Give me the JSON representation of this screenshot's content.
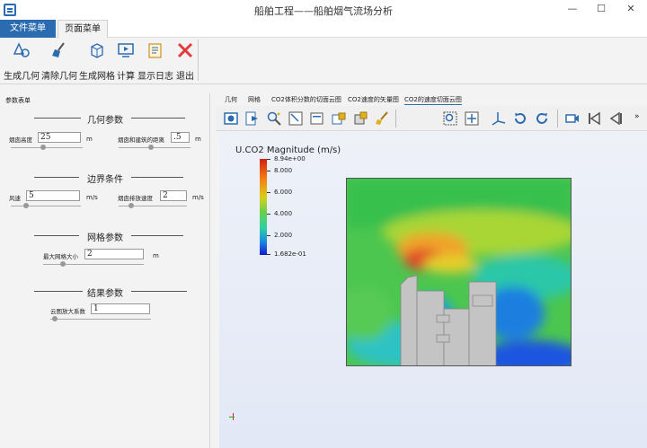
{
  "window": {
    "title": "船舶工程——船舶烟气流场分析",
    "minimize": "—",
    "restore": "☐",
    "close": "✕"
  },
  "menu": {
    "file": "文件菜单",
    "page": "页面菜单"
  },
  "toolbar": [
    {
      "label": "生成几何",
      "icon": "shapes-icon"
    },
    {
      "label": "清除几何",
      "icon": "broom-icon"
    },
    {
      "label": "生成网格",
      "icon": "cube-mesh-icon"
    },
    {
      "label": "计算",
      "icon": "monitor-play-icon"
    },
    {
      "label": "显示日志",
      "icon": "log-document-icon"
    },
    {
      "label": "退出",
      "icon": "exit-x-icon"
    }
  ],
  "left_panel": {
    "title": "参数表单",
    "sections": {
      "geometry": "几何参数",
      "boundary": "边界条件",
      "mesh": "网格参数",
      "result": "结果参数"
    },
    "params": {
      "stack_height": {
        "label": "烟囱高度",
        "value": "25",
        "unit": "m"
      },
      "stack_distance": {
        "label": "烟囱和建筑的距离",
        "value": ".5",
        "unit": "m"
      },
      "wind_speed": {
        "label": "风速",
        "value": "5",
        "unit": "m/s"
      },
      "exhaust_speed": {
        "label": "烟囱排放速度",
        "value": "2",
        "unit": "m/s"
      },
      "max_mesh": {
        "label": "最大网格大小",
        "value": "2",
        "unit": "m"
      },
      "contour_scale": {
        "label": "云图放大系数",
        "value": "1",
        "unit": ""
      }
    },
    "slider_levels": {
      "stack_height": 0.45,
      "stack_distance": 0.45,
      "wind_speed": 0.2,
      "exhaust_speed": 0.15,
      "max_mesh": 0.18,
      "contour_scale": 0.02
    }
  },
  "view_tabs": [
    "几何",
    "网格",
    "CO2体积分数的切面云图",
    "CO2速度的矢量图",
    "CO2的速度切面云图"
  ],
  "view_tab_active": 4,
  "view_toolbar_more": "»",
  "legend": {
    "title": "U.CO2 Magnitude (m/s)",
    "ticks": [
      "8.94e+00",
      "8.000",
      "6.000",
      "4.000",
      "2.000",
      "1.682e-01"
    ]
  },
  "colors": {
    "accent": "#2b6cb0",
    "exit": "#e33b3b",
    "field_base": "#3fc25a",
    "building": "#c4c4c4"
  }
}
